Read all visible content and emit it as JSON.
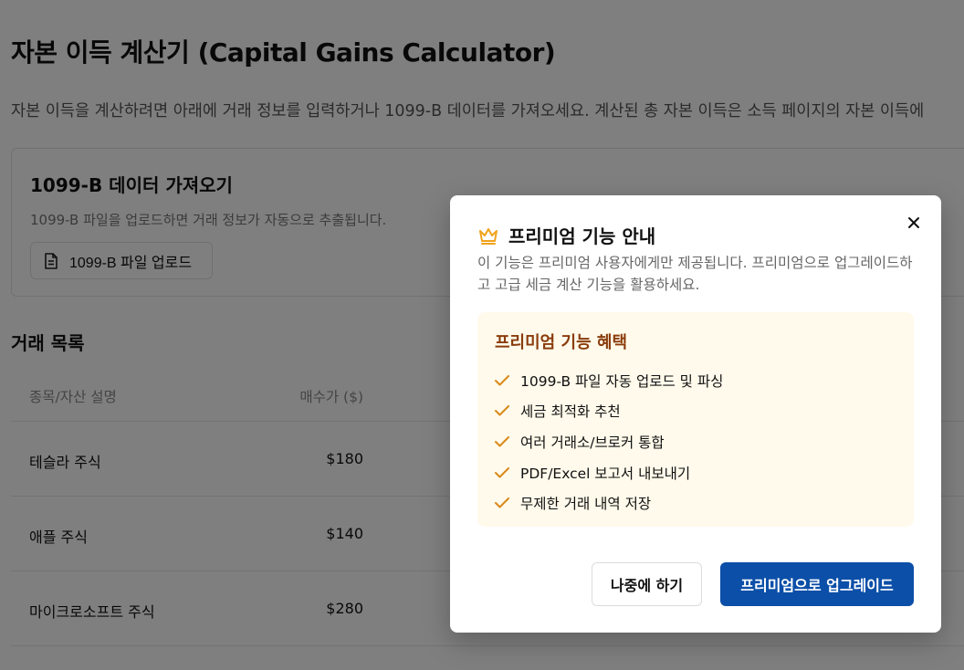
{
  "page": {
    "title": "자본 이득 계산기 (Capital Gains Calculator)",
    "description": "자본 이득을 계산하려면 아래에 거래 정보를 입력하거나 1099-B 데이터를 가져오세요. 계산된 총 자본 이득은 소득 페이지의 자본 이득에"
  },
  "import_card": {
    "title": "1099-B 데이터 가져오기",
    "description": "1099-B 파일을 업로드하면 거래 정보가 자동으로 추출됩니다.",
    "upload_label": "1099-B 파일 업로드",
    "upload_icon": "document-icon"
  },
  "transactions": {
    "title": "거래 목록",
    "columns": [
      "종목/자산 설명",
      "매수가 ($)"
    ],
    "rows": [
      {
        "name": "테슬라 주식",
        "price": "$180"
      },
      {
        "name": "애플 주식",
        "price": "$140"
      },
      {
        "name": "마이크로소프트 주식",
        "price": "$280"
      }
    ]
  },
  "modal": {
    "icon": "crown-icon",
    "title": "프리미엄 기능 안내",
    "description": "이 기능은 프리미엄 사용자에게만 제공됩니다. 프리미엄으로 업그레이드하고 고급 세금 계산 기능을 활용하세요.",
    "benefits_title": "프리미엄 기능 혜택",
    "benefits": [
      "1099-B 파일 자동 업로드 및 파싱",
      "세금 최적화 추천",
      "여러 거래소/브로커 통합",
      "PDF/Excel 보고서 내보내기",
      "무제한 거래 내역 저장"
    ],
    "later_label": "나중에 하기",
    "upgrade_label": "프리미엄으로 업그레이드"
  },
  "colors": {
    "accent": "#0b4fa8",
    "crown": "#f0a21a",
    "benefit_bg": "#fffaeb",
    "benefit_title": "#8a3c0c",
    "check": "#d98a1a"
  }
}
